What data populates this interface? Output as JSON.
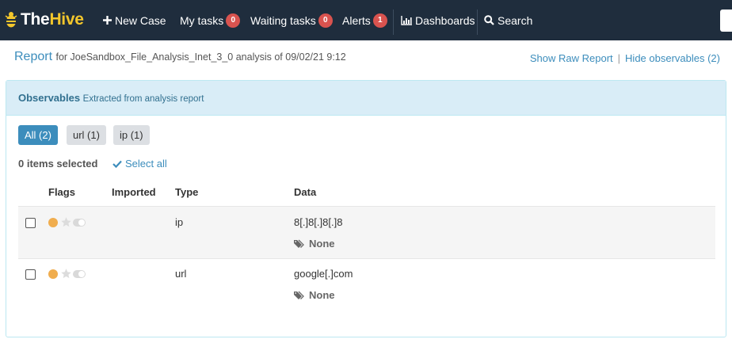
{
  "nav": {
    "brand_the": "The",
    "brand_hive": "Hive",
    "new_case": "New Case",
    "my_tasks": "My tasks",
    "my_tasks_count": "0",
    "waiting_tasks": "Waiting tasks",
    "waiting_tasks_count": "0",
    "alerts": "Alerts",
    "alerts_count": "1",
    "dashboards": "Dashboards",
    "search": "Search"
  },
  "header": {
    "title": "Report",
    "subtitle": "for JoeSandbox_File_Analysis_Inet_3_0 analysis of 09/02/21 9:12",
    "show_raw_report": "Show Raw Report",
    "separator": "|",
    "hide_observables": "Hide observables (2)"
  },
  "panel": {
    "title": "Observables",
    "subtitle": "Extracted from analysis report",
    "filters": [
      {
        "label": "All (2)",
        "active": true
      },
      {
        "label": "url (1)",
        "active": false
      },
      {
        "label": "ip (1)",
        "active": false
      }
    ],
    "selected_count": "0 items selected",
    "select_all": "Select all",
    "columns": {
      "flags": "Flags",
      "imported": "Imported",
      "type": "Type",
      "data": "Data"
    },
    "rows": [
      {
        "type": "ip",
        "data": "8[.]8[.]8[.]8",
        "tags": "None"
      },
      {
        "type": "url",
        "data": "google[.]com",
        "tags": "None"
      }
    ]
  },
  "colors": {
    "navbar_bg": "#1f2d3d",
    "accent": "#3c8dbc",
    "badge": "#d9534f",
    "brand_yellow": "#f2c62c",
    "flag_dot": "#f0ad4e",
    "panel_heading_bg": "#d9edf7"
  },
  "icons": [
    "hive-bee-icon",
    "plus-icon",
    "bar-chart-icon",
    "search-icon",
    "check-icon",
    "star-icon",
    "toggle-icon",
    "tags-icon"
  ]
}
